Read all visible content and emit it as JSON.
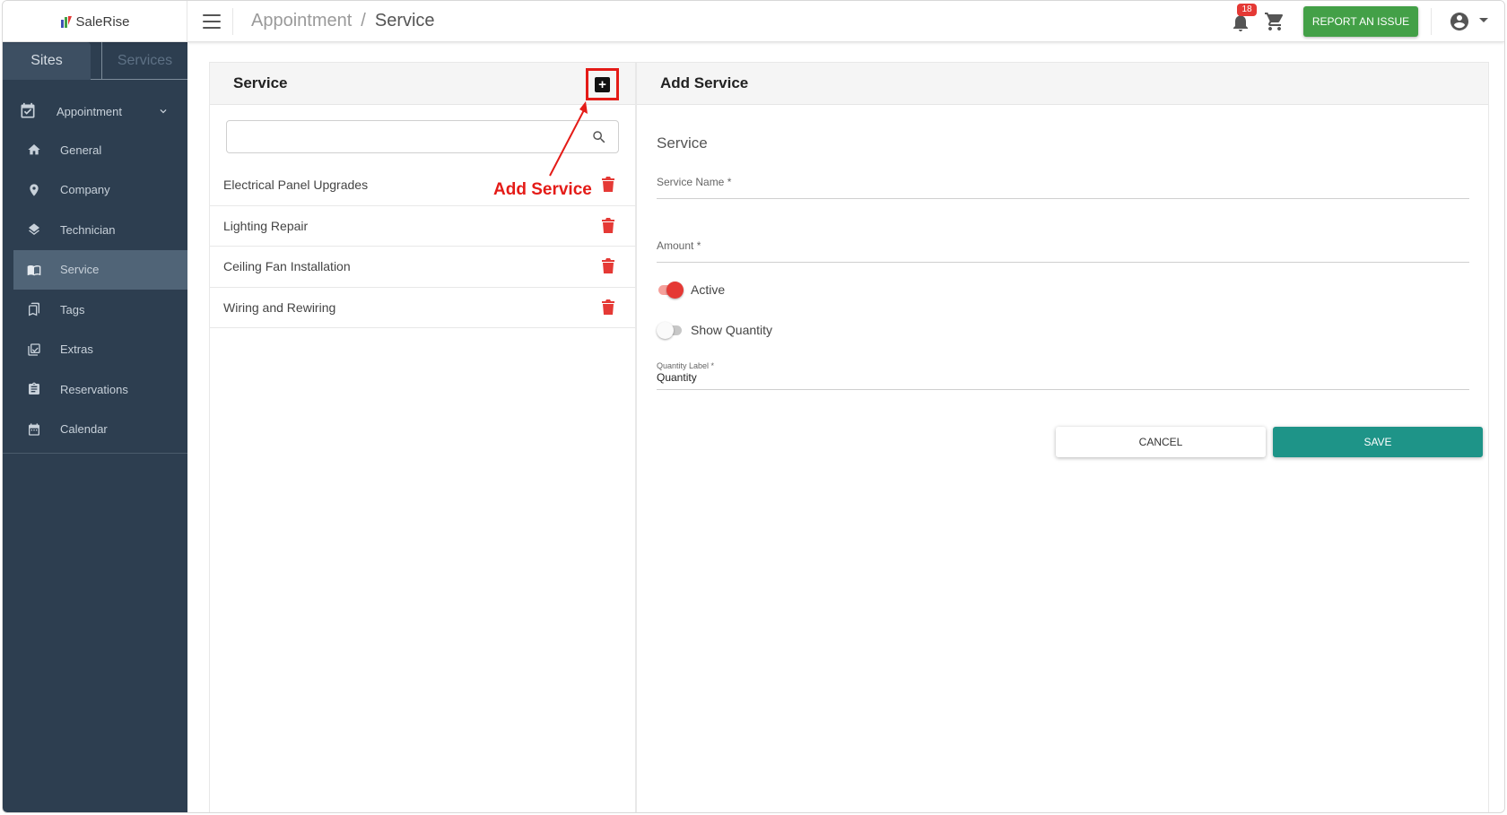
{
  "app": {
    "logo_text": "SaleRise"
  },
  "header": {
    "breadcrumb": [
      "Appointment",
      "Service"
    ],
    "breadcrumb_sep": "/",
    "notification_count": "18",
    "report_label": "REPORT AN ISSUE"
  },
  "sidebar": {
    "tabs": [
      "Sites",
      "Services"
    ],
    "group": {
      "label": "Appointment",
      "icon": "calendar-check-icon"
    },
    "items": [
      {
        "label": "General",
        "icon": "home-icon"
      },
      {
        "label": "Company",
        "icon": "location-pin-icon"
      },
      {
        "label": "Technician",
        "icon": "layers-icon"
      },
      {
        "label": "Service",
        "icon": "book-icon",
        "active": true
      },
      {
        "label": "Tags",
        "icon": "bookmarks-icon"
      },
      {
        "label": "Extras",
        "icon": "checklist-icon"
      },
      {
        "label": "Reservations",
        "icon": "clipboard-icon"
      },
      {
        "label": "Calendar",
        "icon": "calendar-icon"
      }
    ]
  },
  "list_panel": {
    "title": "Service",
    "search_placeholder": "",
    "services": [
      "Electrical Panel Upgrades",
      "Lighting Repair",
      "Ceiling Fan Installation",
      "Wiring and Rewiring"
    ],
    "annotation": "Add Service"
  },
  "form_panel": {
    "title": "Add Service",
    "section_title": "Service",
    "service_name_label": "Service Name *",
    "amount_label": "Amount *",
    "active_label": "Active",
    "active_on": true,
    "show_quantity_label": "Show Quantity",
    "show_quantity_on": false,
    "quantity_label_label": "Quantity Label *",
    "quantity_label_value": "Quantity",
    "cancel_label": "CANCEL",
    "save_label": "SAVE"
  },
  "colors": {
    "sidebar_bg": "#2d3e50",
    "sidebar_active": "#506477",
    "report_green": "#43a047",
    "save_teal": "#1e9488",
    "delete_red": "#e53935",
    "annotation_red": "#e41b17"
  }
}
